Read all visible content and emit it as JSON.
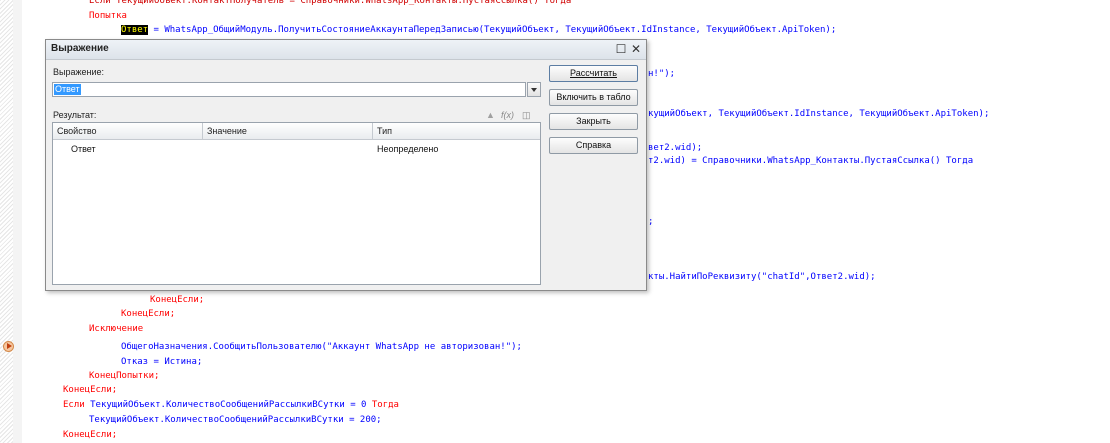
{
  "code_lines": [
    "Попытка",
    "КонецЕсли;",
    "КонецЕсли;",
    "Исключение",
    "ОбщегоНазначения.СообщитьПользователю(\"Аккаунт WhatsApp не авторизован!\");",
    "Отказ = Истина;",
    "КонецПопытки;",
    "КонецЕсли;",
    "Если ТекущийОбъект.КоличествоСообщенийРассылкиВСутки = 0 Тогда",
    "ТекущийОбъект.КоличествоСообщенийРассылкиВСутки = 200;",
    "КонецЕсли;"
  ],
  "code_line2": {
    "highlight": "Ответ",
    "rest": " = WhatsApp_ОбщийМодуль.ПолучитьСостояниеАккаунтаПередЗаписью(ТекущийОбъект, ТекущийОбъект.IdInstance, ТекущийОбъект.ApiToken);"
  },
  "code_fragments": [
    "н!\");",
    "кущийОбъект, ТекущийОбъект.IdInstance, ТекущийОбъект.ApiToken);",
    "вет2.wid);",
    "т2.wid) = Справочники.WhatsApp_Контакты.ПустаяСсылка() Тогда",
    ";",
    "кты.НайтиПоРеквизиту(\"chatId\",Ответ2.wid);"
  ],
  "dialog": {
    "title": "Выражение",
    "expression_label": "Выражение:",
    "expression_value": "Ответ",
    "result_label": "Результат:",
    "columns": [
      "Свойство",
      "Значение",
      "Тип"
    ],
    "rows": [
      {
        "property": "Ответ",
        "value": "",
        "type": "Неопределено"
      }
    ],
    "buttons": {
      "calculate": "Рассчитать",
      "include_in_table": "Включить в табло",
      "close": "Закрыть",
      "help": "Справка"
    },
    "window_controls": {
      "maximize": "☐",
      "close": "✕"
    }
  }
}
